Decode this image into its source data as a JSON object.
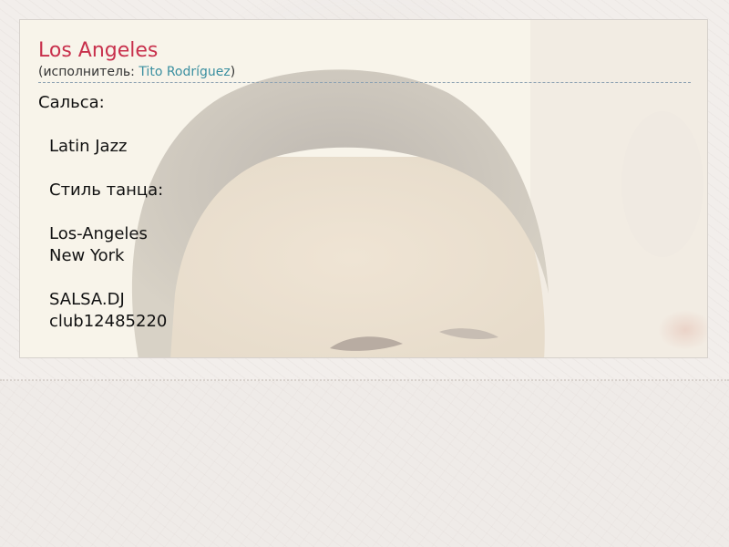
{
  "post": {
    "title": "Los Angeles",
    "byline_prefix": "(исполнитель: ",
    "artist": "Tito Rodríguez",
    "byline_suffix": ")"
  },
  "content": {
    "salsa_label": "Сальса:",
    "genre": "Latin Jazz",
    "dance_style_label": "Стиль танца:",
    "style_1": "Los-Angeles",
    "style_2": "New York",
    "dj": "SALSA.DJ",
    "club": "club12485220"
  },
  "colors": {
    "title": "#c8304c",
    "artist_link": "#3a8fa0",
    "card_background": "#f8f4ea",
    "page_background": "#efebe8"
  },
  "background_image": "faded portrait photo of a man"
}
